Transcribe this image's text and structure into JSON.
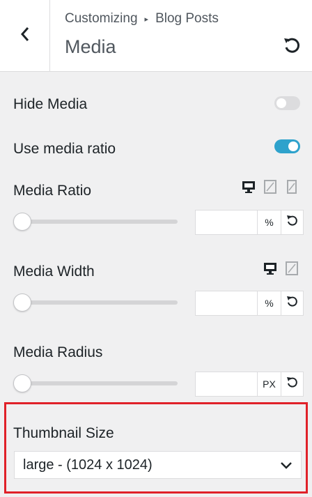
{
  "header": {
    "breadcrumb_parent": "Customizing",
    "breadcrumb_separator": "▸",
    "breadcrumb_current": "Blog Posts",
    "section_title": "Media"
  },
  "controls": {
    "hide_media": {
      "label": "Hide Media",
      "enabled": false
    },
    "use_media_ratio": {
      "label": "Use media ratio",
      "enabled": true
    },
    "media_ratio": {
      "label": "Media Ratio",
      "value": "",
      "unit": "%",
      "devices": [
        "desktop-icon",
        "tablet-icon",
        "mobile-icon"
      ],
      "active_device": "desktop"
    },
    "media_width": {
      "label": "Media Width",
      "value": "",
      "unit": "%",
      "devices": [
        "desktop-icon",
        "tablet-icon"
      ],
      "active_device": "desktop"
    },
    "media_radius": {
      "label": "Media Radius",
      "value": "",
      "unit": "PX"
    },
    "thumbnail_size": {
      "label": "Thumbnail Size",
      "selected": "large - (1024 x 1024)"
    }
  },
  "colors": {
    "toggle_on": "#2ea2cc",
    "toggle_off": "#dcdcde",
    "highlight_border": "#e02129",
    "panel_bg": "#f0f0f1"
  }
}
